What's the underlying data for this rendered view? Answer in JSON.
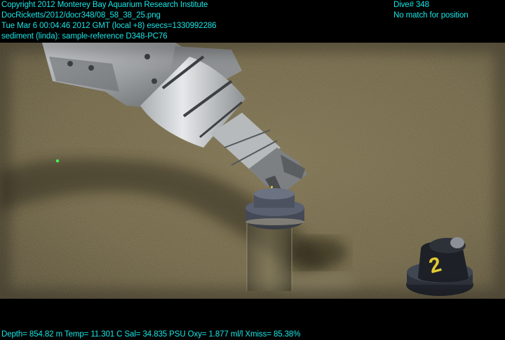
{
  "header": {
    "copyright": "Copyright 2012 Monterey Bay Aquarium Research Institute",
    "filename": "DocRicketts/2012/docr348/08_58_38_25.png",
    "timestamp": "Tue Mar  6 00:04:46 2012 GMT (local +8)  esecs=1330992286",
    "annotation": "sediment (linda): sample-reference D348-PC76",
    "dive": "Dive# 348",
    "position": "No match for position"
  },
  "footer": {
    "telemetry": "Depth= 854.82 m  Temp= 11.301 C  Sal= 34.835 PSU  Oxy= 1.877 ml/l  Xmiss= 85.38%"
  },
  "scene": {
    "core_label": "2",
    "colors": {
      "overlay_text": "#19e6e6",
      "sediment": "#6e6343",
      "background": "#000000"
    }
  }
}
